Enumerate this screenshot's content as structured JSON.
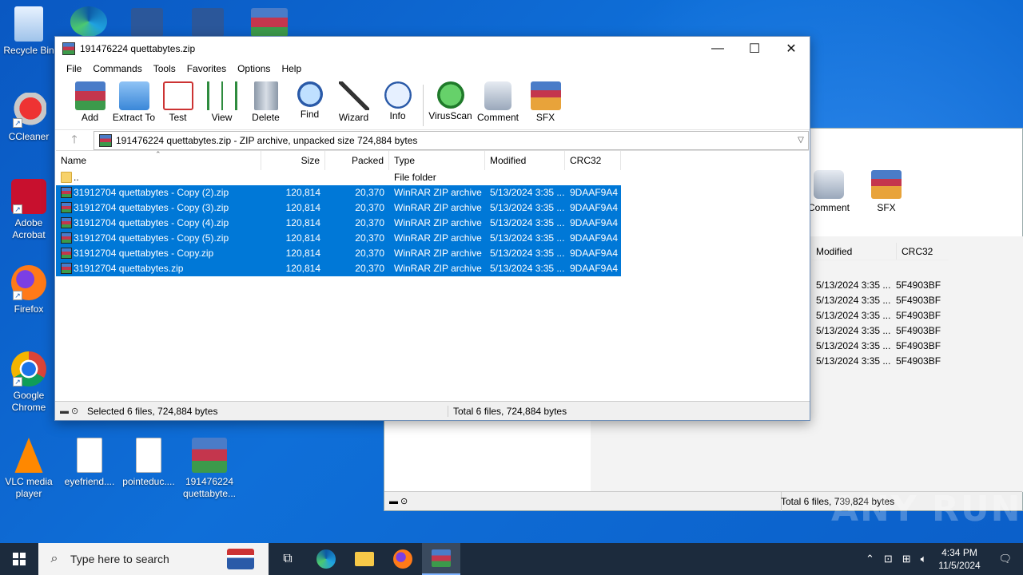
{
  "desktop": {
    "icons": [
      {
        "label": "Recycle Bin"
      },
      {
        "label": "CCleaner"
      },
      {
        "label": "Adobe Acrobat"
      },
      {
        "label": "Firefox"
      },
      {
        "label": "Google Chrome"
      },
      {
        "label": "VLC media player"
      },
      {
        "label": "eyefriend...."
      },
      {
        "label": "pointeduc...."
      },
      {
        "label": "191476224 quettabyte..."
      }
    ]
  },
  "bg_window": {
    "toolbar": [
      "Comment",
      "SFX"
    ],
    "columns": [
      "Modified",
      "CRC32"
    ],
    "rows": [
      {
        "modified": "5/13/2024 3:35 ...",
        "crc": "5F4903BF"
      },
      {
        "modified": "5/13/2024 3:35 ...",
        "crc": "5F4903BF"
      },
      {
        "modified": "5/13/2024 3:35 ...",
        "crc": "5F4903BF"
      },
      {
        "modified": "5/13/2024 3:35 ...",
        "crc": "5F4903BF"
      },
      {
        "modified": "5/13/2024 3:35 ...",
        "crc": "5F4903BF"
      },
      {
        "modified": "5/13/2024 3:35 ...",
        "crc": "5F4903BF"
      }
    ],
    "status": "Total 6 files, 739,824 bytes"
  },
  "window": {
    "title": "191476224 quettabytes.zip",
    "menu": [
      "File",
      "Commands",
      "Tools",
      "Favorites",
      "Options",
      "Help"
    ],
    "toolbar": [
      "Add",
      "Extract To",
      "Test",
      "View",
      "Delete",
      "Find",
      "Wizard",
      "Info",
      "VirusScan",
      "Comment",
      "SFX"
    ],
    "address": "191476224 quettabytes.zip - ZIP archive, unpacked size 724,884 bytes",
    "columns": {
      "name": "Name",
      "size": "Size",
      "packed": "Packed",
      "type": "Type",
      "modified": "Modified",
      "crc": "CRC32"
    },
    "parent": {
      "name": "..",
      "type": "File folder"
    },
    "files": [
      {
        "name": "31912704 quettabytes - Copy (2).zip",
        "size": "120,814",
        "packed": "20,370",
        "type": "WinRAR ZIP archive",
        "modified": "5/13/2024 3:35 ...",
        "crc": "9DAAF9A4"
      },
      {
        "name": "31912704 quettabytes - Copy (3).zip",
        "size": "120,814",
        "packed": "20,370",
        "type": "WinRAR ZIP archive",
        "modified": "5/13/2024 3:35 ...",
        "crc": "9DAAF9A4"
      },
      {
        "name": "31912704 quettabytes - Copy (4).zip",
        "size": "120,814",
        "packed": "20,370",
        "type": "WinRAR ZIP archive",
        "modified": "5/13/2024 3:35 ...",
        "crc": "9DAAF9A4"
      },
      {
        "name": "31912704 quettabytes - Copy (5).zip",
        "size": "120,814",
        "packed": "20,370",
        "type": "WinRAR ZIP archive",
        "modified": "5/13/2024 3:35 ...",
        "crc": "9DAAF9A4"
      },
      {
        "name": "31912704 quettabytes - Copy.zip",
        "size": "120,814",
        "packed": "20,370",
        "type": "WinRAR ZIP archive",
        "modified": "5/13/2024 3:35 ...",
        "crc": "9DAAF9A4"
      },
      {
        "name": "31912704 quettabytes.zip",
        "size": "120,814",
        "packed": "20,370",
        "type": "WinRAR ZIP archive",
        "modified": "5/13/2024 3:35 ...",
        "crc": "9DAAF9A4"
      }
    ],
    "status_left": "Selected 6 files, 724,884 bytes",
    "status_right": "Total 6 files, 724,884 bytes"
  },
  "taskbar": {
    "search_placeholder": "Type here to search",
    "time": "4:34 PM",
    "date": "11/5/2024"
  },
  "watermark": "ANY RUN",
  "colors": {
    "selection": "#0078d7",
    "desktop": "#0f6fd8",
    "taskbar": "#1c2b3d"
  }
}
